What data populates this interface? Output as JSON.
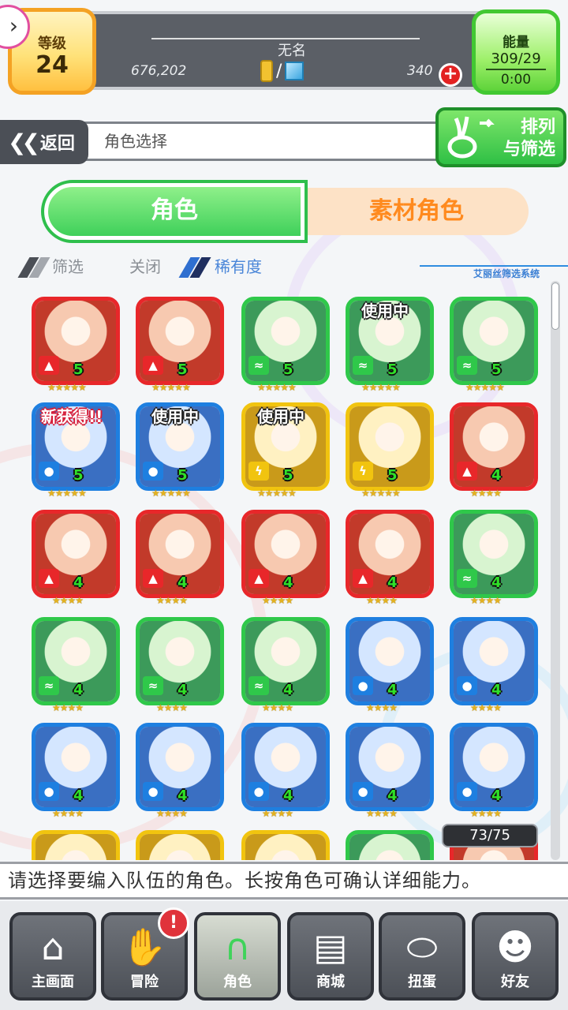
{
  "status": {
    "level_label": "等级",
    "level_value": "24",
    "player_name": "无名",
    "money": "676,202",
    "gem_count": "340",
    "energy_label": "能量",
    "energy_value": "309/29",
    "energy_timer": "0:00"
  },
  "nav": {
    "back_label": "返回",
    "breadcrumb": "角色选择",
    "sort_label_line1": "排列",
    "sort_label_line2": "与筛选"
  },
  "tabs": {
    "characters": "角色",
    "material": "素材角色"
  },
  "filter": {
    "filter_label": "筛选",
    "filter_state": "关闭",
    "rarity_label": "稀有度",
    "system_label": "艾丽丝筛选系统"
  },
  "colors": {
    "fire": "#e8272a",
    "wind": "#2fc84a",
    "water": "#1e7fe0",
    "thunder": "#f1c40f"
  },
  "cards": [
    {
      "element": "fire",
      "elem_icon": "flame-icon",
      "rank": "5",
      "stars": "★★★★★",
      "tag": ""
    },
    {
      "element": "fire",
      "elem_icon": "flame-icon",
      "rank": "5",
      "stars": "★★★★★",
      "tag": ""
    },
    {
      "element": "wind",
      "elem_icon": "wind-icon",
      "rank": "5",
      "stars": "★★★★★",
      "tag": ""
    },
    {
      "element": "wind",
      "elem_icon": "wind-icon",
      "rank": "5",
      "stars": "★★★★★",
      "tag": "使用中"
    },
    {
      "element": "wind",
      "elem_icon": "wind-icon",
      "rank": "5",
      "stars": "★★★★★",
      "tag": ""
    },
    {
      "element": "water",
      "elem_icon": "drop-icon",
      "rank": "5",
      "stars": "★★★★★",
      "tag": "新获得!!"
    },
    {
      "element": "water",
      "elem_icon": "drop-icon",
      "rank": "5",
      "stars": "★★★★★",
      "tag": "使用中"
    },
    {
      "element": "thunder",
      "elem_icon": "bolt-icon",
      "rank": "5",
      "stars": "★★★★★",
      "tag": "使用中"
    },
    {
      "element": "thunder",
      "elem_icon": "bolt-icon",
      "rank": "5",
      "stars": "★★★★★",
      "tag": ""
    },
    {
      "element": "fire",
      "elem_icon": "flame-icon",
      "rank": "4",
      "stars": "★★★★",
      "tag": ""
    },
    {
      "element": "fire",
      "elem_icon": "flame-icon",
      "rank": "4",
      "stars": "★★★★",
      "tag": ""
    },
    {
      "element": "fire",
      "elem_icon": "flame-icon",
      "rank": "4",
      "stars": "★★★★",
      "tag": ""
    },
    {
      "element": "fire",
      "elem_icon": "flame-icon",
      "rank": "4",
      "stars": "★★★★",
      "tag": ""
    },
    {
      "element": "fire",
      "elem_icon": "flame-icon",
      "rank": "4",
      "stars": "★★★★",
      "tag": ""
    },
    {
      "element": "wind",
      "elem_icon": "wind-icon",
      "rank": "4",
      "stars": "★★★★",
      "tag": ""
    },
    {
      "element": "wind",
      "elem_icon": "wind-icon",
      "rank": "4",
      "stars": "★★★★",
      "tag": ""
    },
    {
      "element": "wind",
      "elem_icon": "wind-icon",
      "rank": "4",
      "stars": "★★★★",
      "tag": ""
    },
    {
      "element": "wind",
      "elem_icon": "wind-icon",
      "rank": "4",
      "stars": "★★★★",
      "tag": ""
    },
    {
      "element": "water",
      "elem_icon": "drop-icon",
      "rank": "4",
      "stars": "★★★★",
      "tag": ""
    },
    {
      "element": "water",
      "elem_icon": "drop-icon",
      "rank": "4",
      "stars": "★★★★",
      "tag": ""
    },
    {
      "element": "water",
      "elem_icon": "drop-icon",
      "rank": "4",
      "stars": "★★★★",
      "tag": ""
    },
    {
      "element": "water",
      "elem_icon": "drop-icon",
      "rank": "4",
      "stars": "★★★★",
      "tag": ""
    },
    {
      "element": "water",
      "elem_icon": "drop-icon",
      "rank": "4",
      "stars": "★★★★",
      "tag": ""
    },
    {
      "element": "water",
      "elem_icon": "drop-icon",
      "rank": "4",
      "stars": "★★★★",
      "tag": ""
    },
    {
      "element": "water",
      "elem_icon": "drop-icon",
      "rank": "4",
      "stars": "★★★★",
      "tag": ""
    },
    {
      "element": "thunder",
      "elem_icon": "bolt-icon",
      "rank": "",
      "stars": "",
      "tag": ""
    },
    {
      "element": "thunder",
      "elem_icon": "bolt-icon",
      "rank": "",
      "stars": "",
      "tag": ""
    },
    {
      "element": "thunder",
      "elem_icon": "bolt-icon",
      "rank": "",
      "stars": "",
      "tag": ""
    },
    {
      "element": "wind",
      "elem_icon": "wind-icon",
      "rank": "",
      "stars": "",
      "tag": ""
    },
    {
      "element": "fire",
      "elem_icon": "flame-icon",
      "rank": "",
      "stars": "",
      "tag": ""
    }
  ],
  "roster_count": "73/75",
  "hint": "请选择要编入队伍的角色。长按角色可确认详细能力。",
  "bottom_nav": [
    {
      "label": "主画面",
      "icon": "home-icon"
    },
    {
      "label": "冒险",
      "icon": "handshake-icon"
    },
    {
      "label": "角色",
      "icon": "rabbit-icon"
    },
    {
      "label": "商城",
      "icon": "cart-icon"
    },
    {
      "label": "扭蛋",
      "icon": "egg-icon"
    },
    {
      "label": "好友",
      "icon": "friends-icon"
    }
  ],
  "adventure_alert": "!"
}
